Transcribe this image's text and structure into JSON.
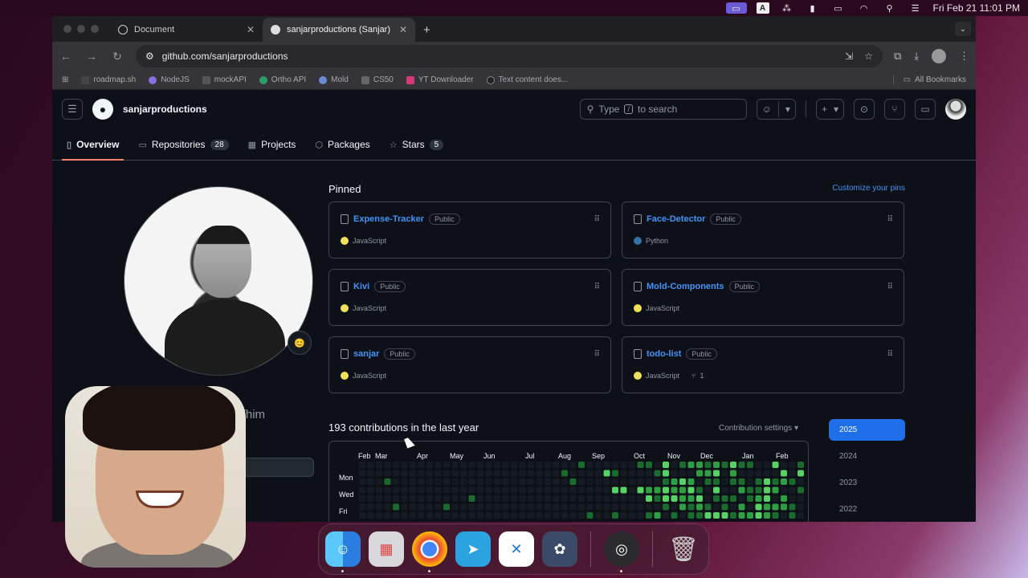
{
  "menubar": {
    "datetime": "Fri Feb 21  11:01 PM",
    "icons": [
      "apple-icon",
      "screen-record-icon",
      "input-source-icon",
      "bluetooth-icon",
      "battery-icon",
      "wifi-icon",
      "search-icon",
      "control-center-icon"
    ]
  },
  "browser": {
    "tabs": [
      {
        "title": "Document",
        "active": false
      },
      {
        "title": "sanjarproductions (Sanjar)",
        "active": true
      }
    ],
    "url": "github.com/sanjarproductions",
    "bookmarks": [
      "roadmap.sh",
      "NodeJS",
      "mockAPI",
      "Ortho API",
      "Mold",
      "CS50",
      "YT Downloader",
      "Text content does..."
    ],
    "all_bookmarks": "All Bookmarks"
  },
  "github": {
    "username": "sanjarproductions",
    "search_placeholder_pre": "Type",
    "search_key": "/",
    "search_placeholder_post": "to search",
    "tabs": [
      {
        "label": "Overview",
        "count": null,
        "icon": "book-icon"
      },
      {
        "label": "Repositories",
        "count": "28",
        "icon": "repo-icon"
      },
      {
        "label": "Projects",
        "count": null,
        "icon": "table-icon"
      },
      {
        "label": "Packages",
        "count": null,
        "icon": "package-icon"
      },
      {
        "label": "Stars",
        "count": "5",
        "icon": "star-icon"
      }
    ],
    "pronoun_partial": "he/him",
    "pinned_title": "Pinned",
    "customize_pins": "Customize your pins",
    "pinned": [
      {
        "name": "Expense-Tracker",
        "visibility": "Public",
        "language": "JavaScript",
        "lang_color": "#f1e05a",
        "forks": null
      },
      {
        "name": "Face-Detector",
        "visibility": "Public",
        "language": "Python",
        "lang_color": "#3572A5",
        "forks": null
      },
      {
        "name": "Kivi",
        "visibility": "Public",
        "language": "JavaScript",
        "lang_color": "#f1e05a",
        "forks": null
      },
      {
        "name": "Mold-Components",
        "visibility": "Public",
        "language": "JavaScript",
        "lang_color": "#f1e05a",
        "forks": null
      },
      {
        "name": "sanjar",
        "visibility": "Public",
        "language": "JavaScript",
        "lang_color": "#f1e05a",
        "forks": null
      },
      {
        "name": "todo-list",
        "visibility": "Public",
        "language": "JavaScript",
        "lang_color": "#f1e05a",
        "forks": "1"
      }
    ],
    "contributions_title": "193 contributions in the last year",
    "contribution_settings": "Contribution settings",
    "months": [
      "Feb",
      "Mar",
      "Apr",
      "May",
      "Jun",
      "Jul",
      "Aug",
      "Sep",
      "Oct",
      "Nov",
      "Dec",
      "Jan",
      "Feb"
    ],
    "day_labels": [
      "Mon",
      "Wed",
      "Fri"
    ],
    "years": [
      "2025",
      "2024",
      "2023",
      "2022"
    ],
    "selected_year": "2025",
    "colors": {
      "level0": "#151b23",
      "level1": "#033a16",
      "level2": "#196c2e",
      "level3": "#2ea043",
      "level4": "#56d364",
      "accent": "#1f6feb",
      "link": "#4493f8"
    }
  },
  "dock": {
    "apps": [
      "Finder",
      "Launchpad",
      "Chrome",
      "Telegram",
      "VS Code",
      "DaVinci Resolve",
      "OBS",
      "Trash"
    ]
  }
}
